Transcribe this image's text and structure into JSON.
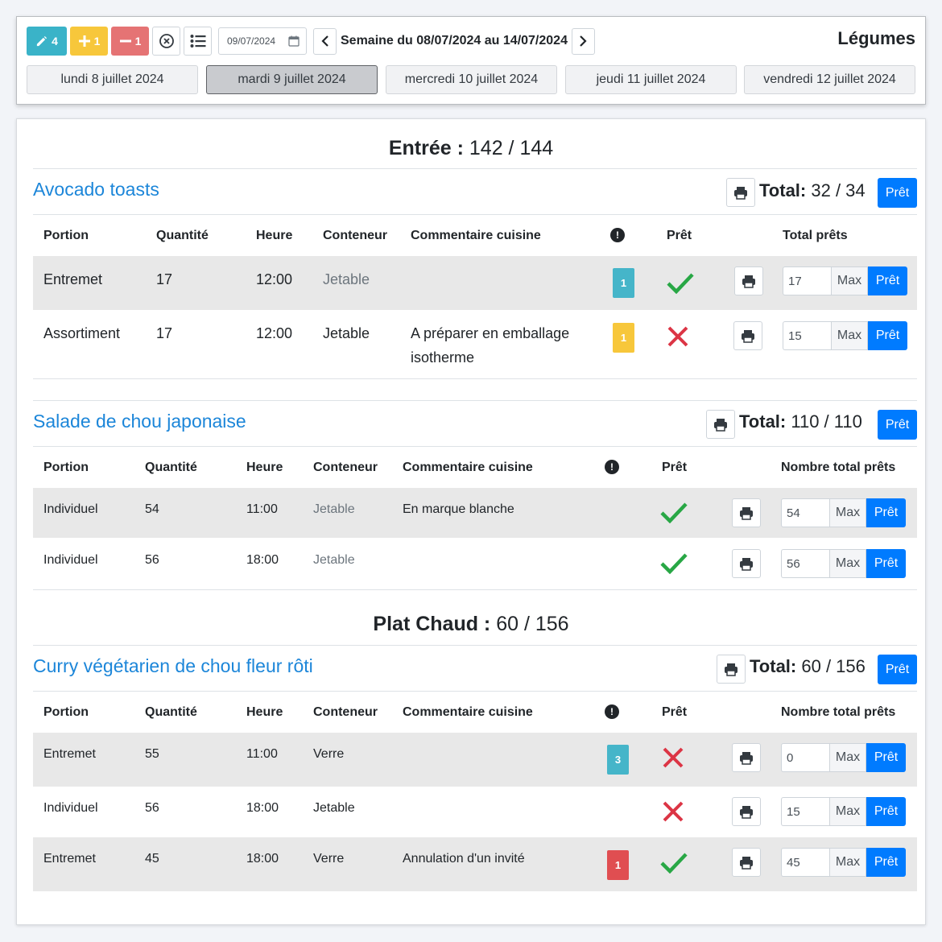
{
  "toolbar": {
    "edit_count": "4",
    "plus_count": "1",
    "minus_count": "1",
    "date_value": "09/07/2024",
    "week_label": "Semaine du 08/07/2024 au 14/07/2024",
    "section_name": "Légumes",
    "days": [
      {
        "label": "lundi 8 juillet 2024"
      },
      {
        "label": "mardi 9 juillet 2024"
      },
      {
        "label": "mercredi 10 juillet 2024"
      },
      {
        "label": "jeudi 11 juillet 2024"
      },
      {
        "label": "vendredi 12 juillet 2024"
      }
    ]
  },
  "colors": {
    "accent": "#007bff",
    "dish": "#1c86d9",
    "edit": "#3ab3c8",
    "plus": "#f7c73b",
    "minus": "#e57374",
    "ready": "#28a745",
    "not_ready": "#dc3545"
  },
  "labels": {
    "total": "Total:",
    "ready_button": "Prêt",
    "max": "Max",
    "col_portion": "Portion",
    "col_quantite": "Quantité",
    "col_heure": "Heure",
    "col_conteneur": "Conteneur",
    "col_commentaire": "Commentaire cuisine",
    "col_pret": "Prêt",
    "col_total_prets": "Total prêts",
    "col_nombre_total_prets": "Nombre total prêts"
  },
  "categories": [
    {
      "name": "Entrée :",
      "count": "142 / 144",
      "dishes": [
        {
          "name": "Avocado toasts",
          "total": "32 / 34",
          "rows": [
            {
              "portion": "Entremet",
              "quantite": "17",
              "heure": "12:00",
              "conteneur": "Jetable",
              "commentaire": "",
              "badge": "1",
              "badge_type": "info",
              "ready": true,
              "total_prets": "17"
            },
            {
              "portion": "Assortiment",
              "quantite": "17",
              "heure": "12:00",
              "conteneur": "Jetable",
              "commentaire": "A préparer en emballage isotherme",
              "badge": "1",
              "badge_type": "warn",
              "ready": false,
              "total_prets": "15"
            }
          ]
        },
        {
          "name": "Salade de chou japonaise",
          "total": "110 / 110",
          "rows": [
            {
              "portion": "Individuel",
              "quantite": "54",
              "heure": "11:00",
              "conteneur": "Jetable",
              "commentaire": "En marque blanche",
              "badge": "",
              "badge_type": "",
              "ready": true,
              "total_prets": "54"
            },
            {
              "portion": "Individuel",
              "quantite": "56",
              "heure": "18:00",
              "conteneur": "Jetable",
              "commentaire": "",
              "badge": "",
              "badge_type": "",
              "ready": true,
              "total_prets": "56"
            }
          ]
        }
      ]
    },
    {
      "name": "Plat Chaud :",
      "count": "60 / 156",
      "dishes": [
        {
          "name": "Curry végétarien de chou fleur rôti",
          "total": "60 / 156",
          "rows": [
            {
              "portion": "Entremet",
              "quantite": "55",
              "heure": "11:00",
              "conteneur": "Verre",
              "commentaire": "",
              "badge": "3",
              "badge_type": "info",
              "ready": false,
              "total_prets": "0"
            },
            {
              "portion": "Individuel",
              "quantite": "56",
              "heure": "18:00",
              "conteneur": "Jetable",
              "commentaire": "",
              "badge": "",
              "badge_type": "",
              "ready": false,
              "total_prets": "15"
            },
            {
              "portion": "Entremet",
              "quantite": "45",
              "heure": "18:00",
              "conteneur": "Verre",
              "commentaire": "Annulation d'un invité",
              "badge": "1",
              "badge_type": "danger",
              "ready": true,
              "total_prets": "45"
            }
          ]
        }
      ]
    }
  ]
}
